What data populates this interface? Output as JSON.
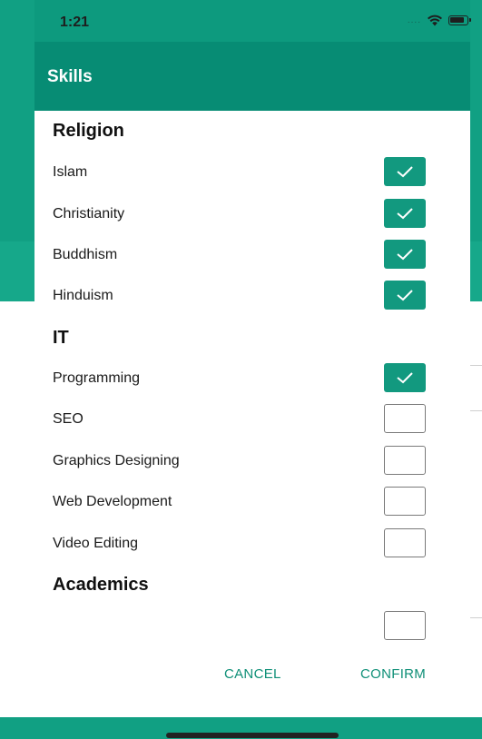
{
  "status_bar": {
    "time": "1:21",
    "signal": "....",
    "wifi_icon": "wifi-icon",
    "battery_icon": "battery-icon"
  },
  "dialog": {
    "title": "Skills",
    "groups": [
      {
        "name": "Religion",
        "items": [
          {
            "label": "Islam",
            "checked": true
          },
          {
            "label": "Christianity",
            "checked": true
          },
          {
            "label": "Buddhism",
            "checked": true
          },
          {
            "label": "Hinduism",
            "checked": true
          }
        ]
      },
      {
        "name": "IT",
        "items": [
          {
            "label": "Programming",
            "checked": true
          },
          {
            "label": "SEO",
            "checked": false
          },
          {
            "label": "Graphics Designing",
            "checked": false
          },
          {
            "label": "Web Development",
            "checked": false
          },
          {
            "label": "Video Editing",
            "checked": false
          }
        ]
      },
      {
        "name": "Academics",
        "items": [
          {
            "label": "",
            "checked": false
          }
        ]
      }
    ],
    "actions": {
      "cancel": "CANCEL",
      "confirm": "CONFIRM"
    }
  },
  "colors": {
    "accent": "#12997f",
    "header": "#078c74",
    "background_app": "#11a083"
  }
}
